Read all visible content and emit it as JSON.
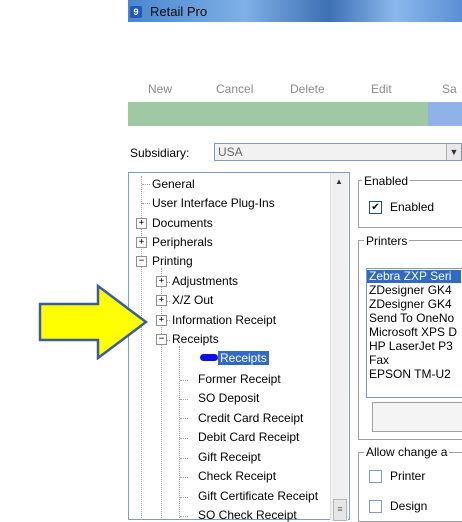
{
  "window": {
    "title": "Retail Pro",
    "icon_text": "9"
  },
  "toolbar": {
    "new_label": "New",
    "cancel_label": "Cancel",
    "delete_label": "Delete",
    "edit_label": "Edit",
    "save_label": "Sa"
  },
  "subsidiary": {
    "label": "Subsidiary:",
    "value": "USA"
  },
  "tree": {
    "items": [
      {
        "label": "General"
      },
      {
        "label": "User Interface Plug-Ins"
      },
      {
        "label": "Documents"
      },
      {
        "label": "Peripherals"
      },
      {
        "label": "Printing"
      },
      {
        "label": "Adjustments"
      },
      {
        "label": "X/Z Out"
      },
      {
        "label": "Information Receipt"
      },
      {
        "label": "Receipts"
      },
      {
        "label": "Receipts"
      },
      {
        "label": "Former Receipt"
      },
      {
        "label": "SO Deposit"
      },
      {
        "label": "Credit Card Receipt"
      },
      {
        "label": "Debit Card Receipt"
      },
      {
        "label": "Gift Receipt"
      },
      {
        "label": "Check Receipt"
      },
      {
        "label": "Gift Certificate Receipt"
      },
      {
        "label": "SO Check Receipt"
      }
    ]
  },
  "enabled": {
    "group_label": "Enabled",
    "checkbox_label": "Enabled",
    "checked": true
  },
  "printers": {
    "group_label": "Printers",
    "items": [
      "Zebra ZXP Seri",
      "ZDesigner GK4",
      "ZDesigner GK4",
      "Send To OneNo",
      "Microsoft XPS D",
      "HP LaserJet P3",
      "Fax",
      "EPSON TM-U2"
    ],
    "selected_index": 0
  },
  "allow_change": {
    "group_label": "Allow change a",
    "options": [
      {
        "label": "Printer"
      },
      {
        "label": "Design"
      }
    ]
  },
  "colors": {
    "arrow_fill": "#ffff00",
    "arrow_stroke": "#3b5ba5",
    "selection": "#316ac5"
  }
}
